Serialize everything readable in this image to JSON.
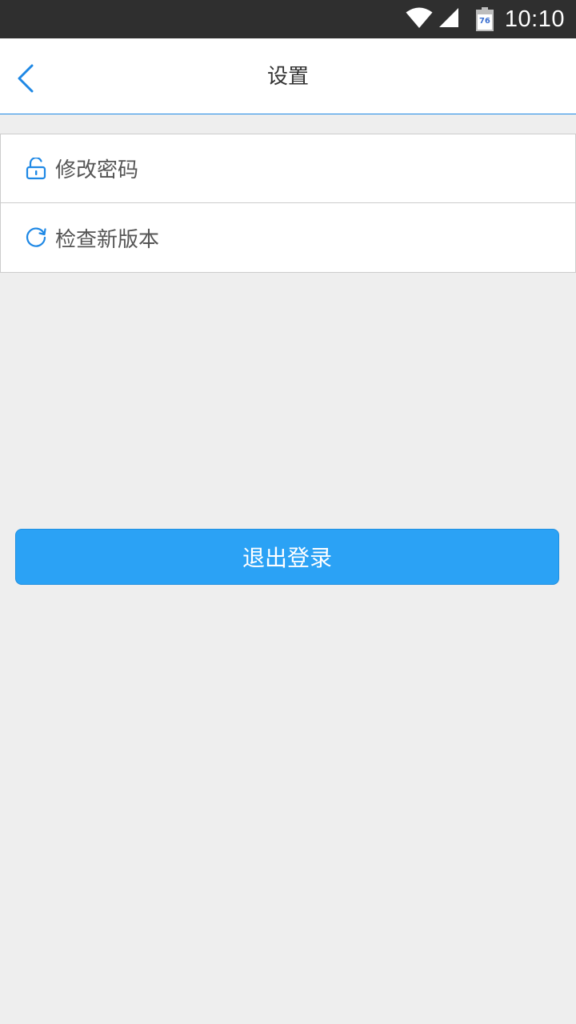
{
  "status_bar": {
    "time": "10:10",
    "battery_level": "76",
    "icons": [
      "wifi-icon",
      "signal-icon",
      "battery-icon"
    ]
  },
  "header": {
    "title": "设置",
    "back_icon": "chevron-left-icon"
  },
  "menu": {
    "items": [
      {
        "label": "修改密码",
        "icon": "unlock-icon"
      },
      {
        "label": "检查新版本",
        "icon": "refresh-icon"
      }
    ]
  },
  "logout": {
    "label": "退出登录"
  },
  "colors": {
    "accent": "#1e88e5",
    "button": "#2ba2f5",
    "background": "#eeeeee",
    "status_bar": "#2f2f2f"
  }
}
